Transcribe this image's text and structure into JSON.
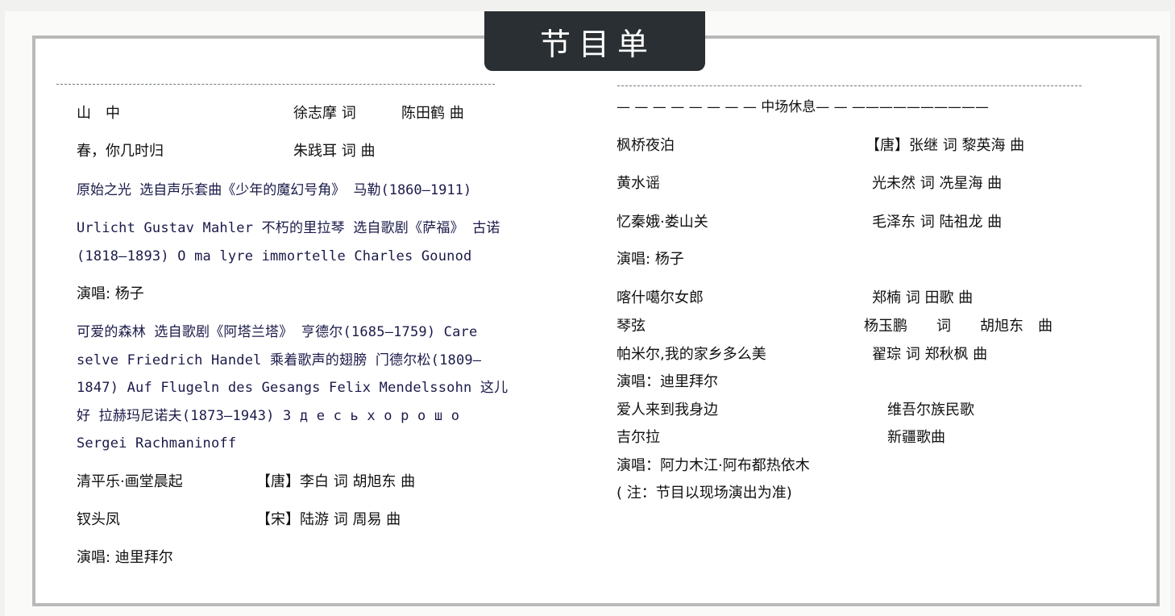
{
  "header": {
    "title": "节目单"
  },
  "left": {
    "rows": [
      {
        "title": "山　中",
        "credit1": "徐志摩 词",
        "credit2": "陈田鹤 曲"
      },
      {
        "title": "春，你几时归",
        "credit1": "朱践耳 词 曲"
      }
    ],
    "para1": "原始之光 选自声乐套曲《少年的魔幻号角》 马勒(1860—1911)",
    "para2": "Urlicht Gustav Mahler 不朽的里拉琴 选自歌剧《萨福》 古诺(1818—1893)  O ma lyre immortelle Charles Gounod",
    "singer1": "演唱: 杨子",
    "para3": "可爱的森林 选自歌剧《阿塔兰塔》 亨德尔(1685—1759) Care selve Friedrich Handel 乘着歌声的翅膀 门德尔松(1809—1847)  Auf Flugeln des Gesangs Felix Mendelssohn 这儿好 拉赫玛尼诺夫(1873—1943) З д е с ь  х о р о ш о Sergei Rachmaninoff",
    "rows2": [
      {
        "title": "清平乐·画堂晨起",
        "credit": "【唐】李白 词 胡旭东 曲"
      },
      {
        "title": "钗头凤",
        "credit": "【宋】陆游 词 周易 曲"
      }
    ],
    "singer2": "演唱: 迪里拜尔"
  },
  "right": {
    "intermission": "— — — — — — — — 中场休息— — ——————————",
    "rows": [
      {
        "title": "枫桥夜泊",
        "credit": "【唐】张继 词 黎英海 曲"
      },
      {
        "title": "黄水谣",
        "credit": "光未然 词 冼星海 曲"
      },
      {
        "title": "忆秦娥·娄山关",
        "credit": "毛泽东 词 陆祖龙 曲"
      }
    ],
    "singer1": "演唱: 杨子",
    "rows2": [
      {
        "title": "喀什噶尔女郎",
        "credit": "郑楠 词 田歌 曲"
      },
      {
        "title": "琴弦",
        "credit": "杨玉鹏　　词　　胡旭东　曲"
      },
      {
        "title": "帕米尔,我的家乡多么美",
        "credit": "翟琮 词 郑秋枫 曲"
      }
    ],
    "singer2": "演唱：迪里拜尔",
    "rows3": [
      {
        "title": "爱人来到我身边",
        "credit": "维吾尔族民歌"
      },
      {
        "title": "吉尔拉",
        "credit": "新疆歌曲"
      }
    ],
    "singer3": "演唱：阿力木江·阿布都热依木",
    "note": "( 注：节目以现场演出为准)"
  }
}
